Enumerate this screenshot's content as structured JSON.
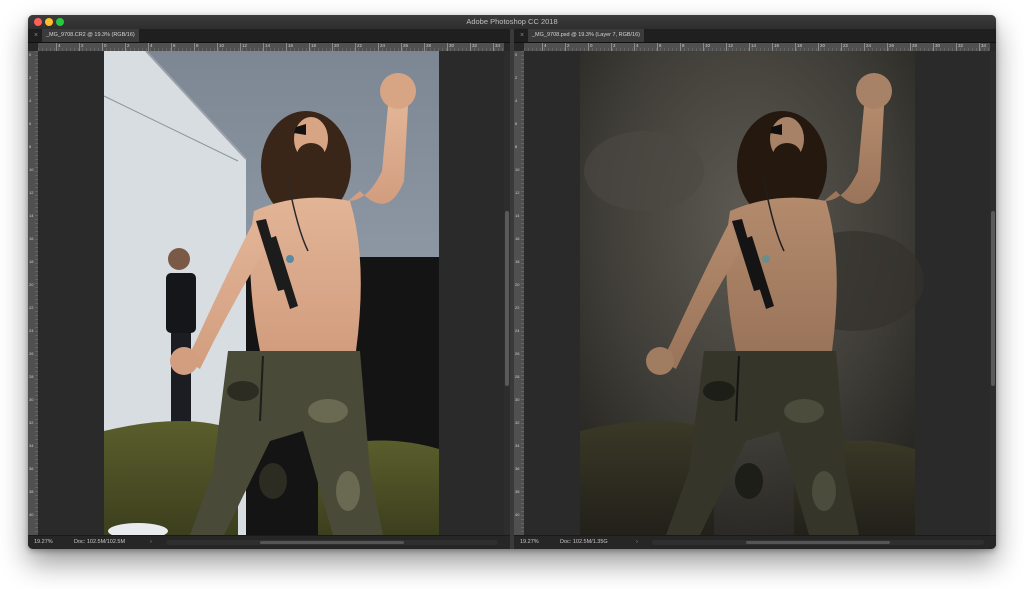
{
  "window": {
    "title": "Adobe Photoshop CC 2018"
  },
  "documents": [
    {
      "tab_title": "_MG_9708.CR2 @ 19.3% (RGB/16)",
      "zoom": "19.27%",
      "doc_size": "Doc: 102.5M/102.5M",
      "ruler_h_labels": [
        "4",
        "2",
        "0",
        "2",
        "4",
        "6",
        "8",
        "10",
        "12",
        "14",
        "16",
        "18",
        "20",
        "22",
        "24",
        "26",
        "28",
        "30",
        "32",
        "34"
      ],
      "ruler_v_labels": [
        "0",
        "2",
        "4",
        "6",
        "8",
        "10",
        "12",
        "14",
        "16",
        "18",
        "20",
        "22",
        "24",
        "26",
        "28",
        "30",
        "32",
        "34",
        "36",
        "38",
        "40"
      ],
      "image": "original-unedited-photo"
    },
    {
      "tab_title": "_MG_9708.psd @ 19.3% (Layer 7, RGB/16)",
      "zoom": "19.27%",
      "doc_size": "Doc: 102.5M/1.35G",
      "ruler_h_labels": [
        "4",
        "2",
        "0",
        "2",
        "4",
        "6",
        "8",
        "10",
        "12",
        "14",
        "16",
        "18",
        "20",
        "22",
        "24",
        "26",
        "28",
        "30",
        "32",
        "34"
      ],
      "ruler_v_labels": [
        "0",
        "2",
        "4",
        "6",
        "8",
        "10",
        "12",
        "14",
        "16",
        "18",
        "20",
        "22",
        "24",
        "26",
        "28",
        "30",
        "32",
        "34",
        "36",
        "38",
        "40"
      ],
      "image": "retouched-composite-photo"
    }
  ],
  "icons": {
    "close": "close-icon",
    "chevron": "chevron-right-icon"
  },
  "colors": {
    "window_bg": "#323232",
    "canvas_bg": "#2a2a2a",
    "camo_dark": "#3b3d2a",
    "olive_drape": "#4e5226",
    "skin_light": "#d9a888",
    "skin_toned": "#a88266",
    "sky": "#7f8a96"
  }
}
